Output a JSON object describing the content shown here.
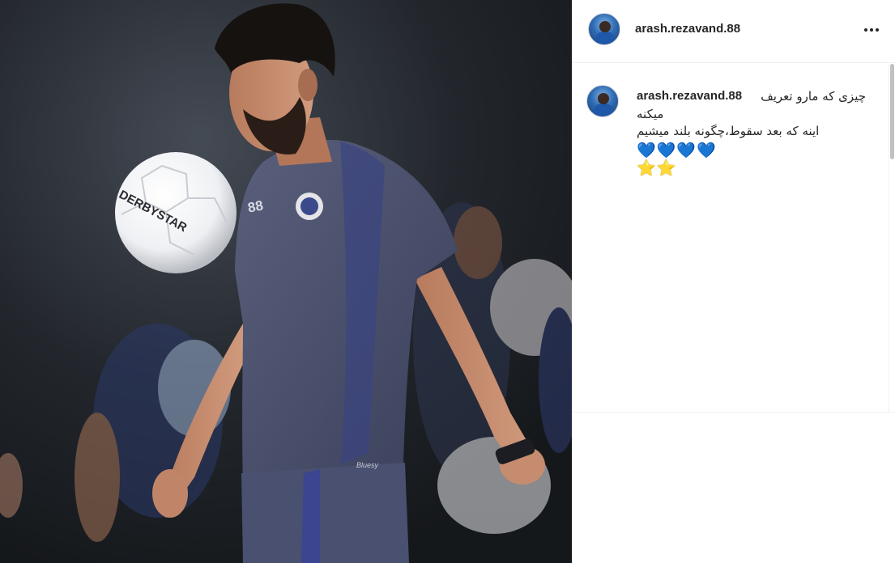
{
  "post": {
    "username": "arash.rezavand.88",
    "more_icon": "more-horizontal-icon"
  },
  "caption": {
    "username": "arash.rezavand.88",
    "line1": "چیزی که مارو تعریف",
    "line2": "میکنه",
    "line3": "اینه که بعد سقوط،چگونه بلند میشیم",
    "hearts": "💙💙💙💙",
    "stars": "⭐⭐"
  },
  "photo": {
    "ball_brand": "DERBYSTAR",
    "jersey_number": "88",
    "shorts_text": "Bluesy"
  },
  "colors": {
    "heart": "#1b74d8",
    "star": "#f0b400",
    "text": "#262626",
    "jersey": "#4a5070"
  }
}
